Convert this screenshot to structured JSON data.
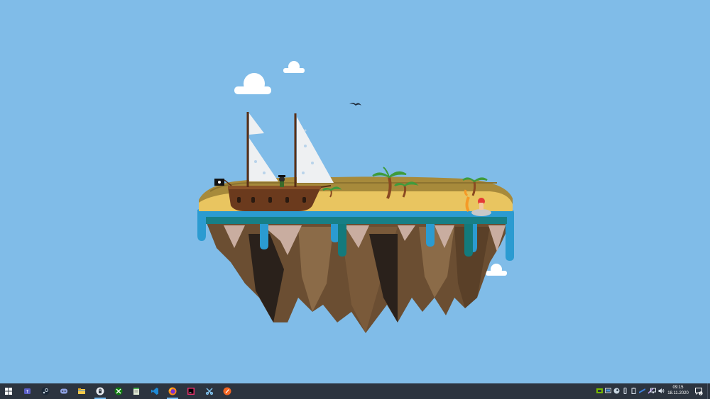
{
  "wallpaper": {
    "name": "floating-island-pirate-ship",
    "sky_color": "#80bce8"
  },
  "taskbar": {
    "background": "#2c343f",
    "start_icon": "windows-logo-icon",
    "pinned_apps": [
      {
        "name": "teams",
        "icon": "teams-icon"
      },
      {
        "name": "steam",
        "icon": "steam-icon"
      },
      {
        "name": "discord",
        "icon": "discord-icon"
      },
      {
        "name": "file-explorer",
        "icon": "folder-icon"
      },
      {
        "name": "proton-vpn",
        "icon": "vpn-icon",
        "active": true
      },
      {
        "name": "xbox",
        "icon": "xbox-icon"
      },
      {
        "name": "notepad",
        "icon": "notepad-icon"
      },
      {
        "name": "vs-code",
        "icon": "vscode-icon"
      },
      {
        "name": "firefox",
        "icon": "firefox-icon",
        "active": true
      },
      {
        "name": "intellij",
        "icon": "intellij-icon"
      },
      {
        "name": "snipping-tool",
        "icon": "snipping-icon"
      },
      {
        "name": "ccleaner",
        "icon": "ccleaner-icon"
      }
    ],
    "tray_icons": [
      "nvidia-icon",
      "display-icon",
      "steam-tray-icon",
      "usb-icon",
      "battery-icon",
      "xbox-tray-icon",
      "pen-icon",
      "network-icon",
      "volume-icon"
    ],
    "clock": {
      "time": "09:15",
      "date": "18.11.2020"
    },
    "notifications": {
      "icon": "notification-icon",
      "count": "2"
    }
  }
}
